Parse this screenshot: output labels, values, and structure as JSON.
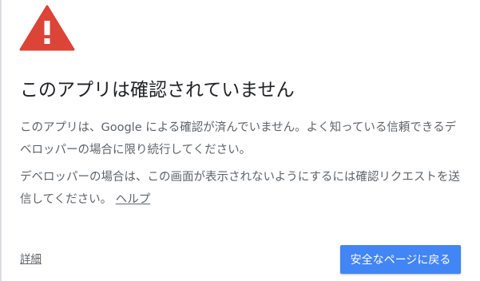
{
  "warning": {
    "icon": "warning-triangle-icon",
    "color": "#db4437"
  },
  "title": "このアプリは確認されていません",
  "paragraph1": "このアプリは、Google による確認が済んでいません。よく知っている信頼できるデベロッパーの場合に限り続行してください。",
  "paragraph2_text": "デベロッパーの場合は、この画面が表示されないようにするには確認リクエストを送信してください。 ",
  "help_link_label": "ヘルプ",
  "details_link_label": "詳細",
  "back_button_label": "安全なページに戻る",
  "colors": {
    "button_bg": "#4285f4",
    "title_text": "#202124",
    "body_text": "#5f6368"
  }
}
